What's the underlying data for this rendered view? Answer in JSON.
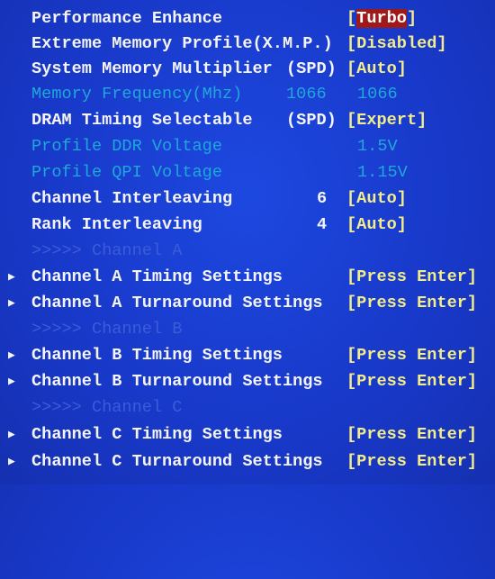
{
  "colors": {
    "background": "#1a3fd0",
    "label": "#f4f4f4",
    "value": "#f2ec8a",
    "disabled": "#1fa8d8",
    "header": "#3c5cd8",
    "selected_bg": "#a01818"
  },
  "rows": [
    {
      "label": "Performance Enhance",
      "value_open": "[",
      "value_sel": "Turbo",
      "value_close": "]"
    },
    {
      "label": "Extreme Memory Profile(X.M.P.)",
      "value": "[Disabled]"
    },
    {
      "label": "System Memory Multiplier",
      "mid": "(SPD)",
      "value": "[Auto]"
    },
    {
      "label": "Memory Frequency(Mhz)",
      "mid": "1066",
      "value": "1066"
    },
    {
      "label": "DRAM Timing Selectable",
      "mid": "(SPD)",
      "value": "[Expert]"
    },
    {
      "label": "Profile DDR Voltage",
      "value": "1.5V"
    },
    {
      "label": "Profile QPI Voltage",
      "value": "1.15V"
    },
    {
      "label": "Channel Interleaving",
      "num": "6",
      "value": "[Auto]"
    },
    {
      "label": "Rank Interleaving",
      "num": "4",
      "value": "[Auto]"
    },
    {
      "label": ">>>>> Channel A"
    },
    {
      "label": "Channel A Timing Settings",
      "value": "[Press Enter]"
    },
    {
      "label": "Channel A Turnaround Settings",
      "value": "[Press Enter]"
    },
    {
      "label": ">>>>> Channel B"
    },
    {
      "label": "Channel B Timing Settings",
      "value": "[Press Enter]"
    },
    {
      "label": "Channel B Turnaround Settings",
      "value": "[Press Enter]"
    },
    {
      "label": ">>>>> Channel C"
    },
    {
      "label": "Channel C Timing Settings",
      "value": "[Press Enter]"
    },
    {
      "label": "Channel C Turnaround Settings",
      "value": "[Press Enter]"
    }
  ],
  "submenu_arrow": "▶"
}
